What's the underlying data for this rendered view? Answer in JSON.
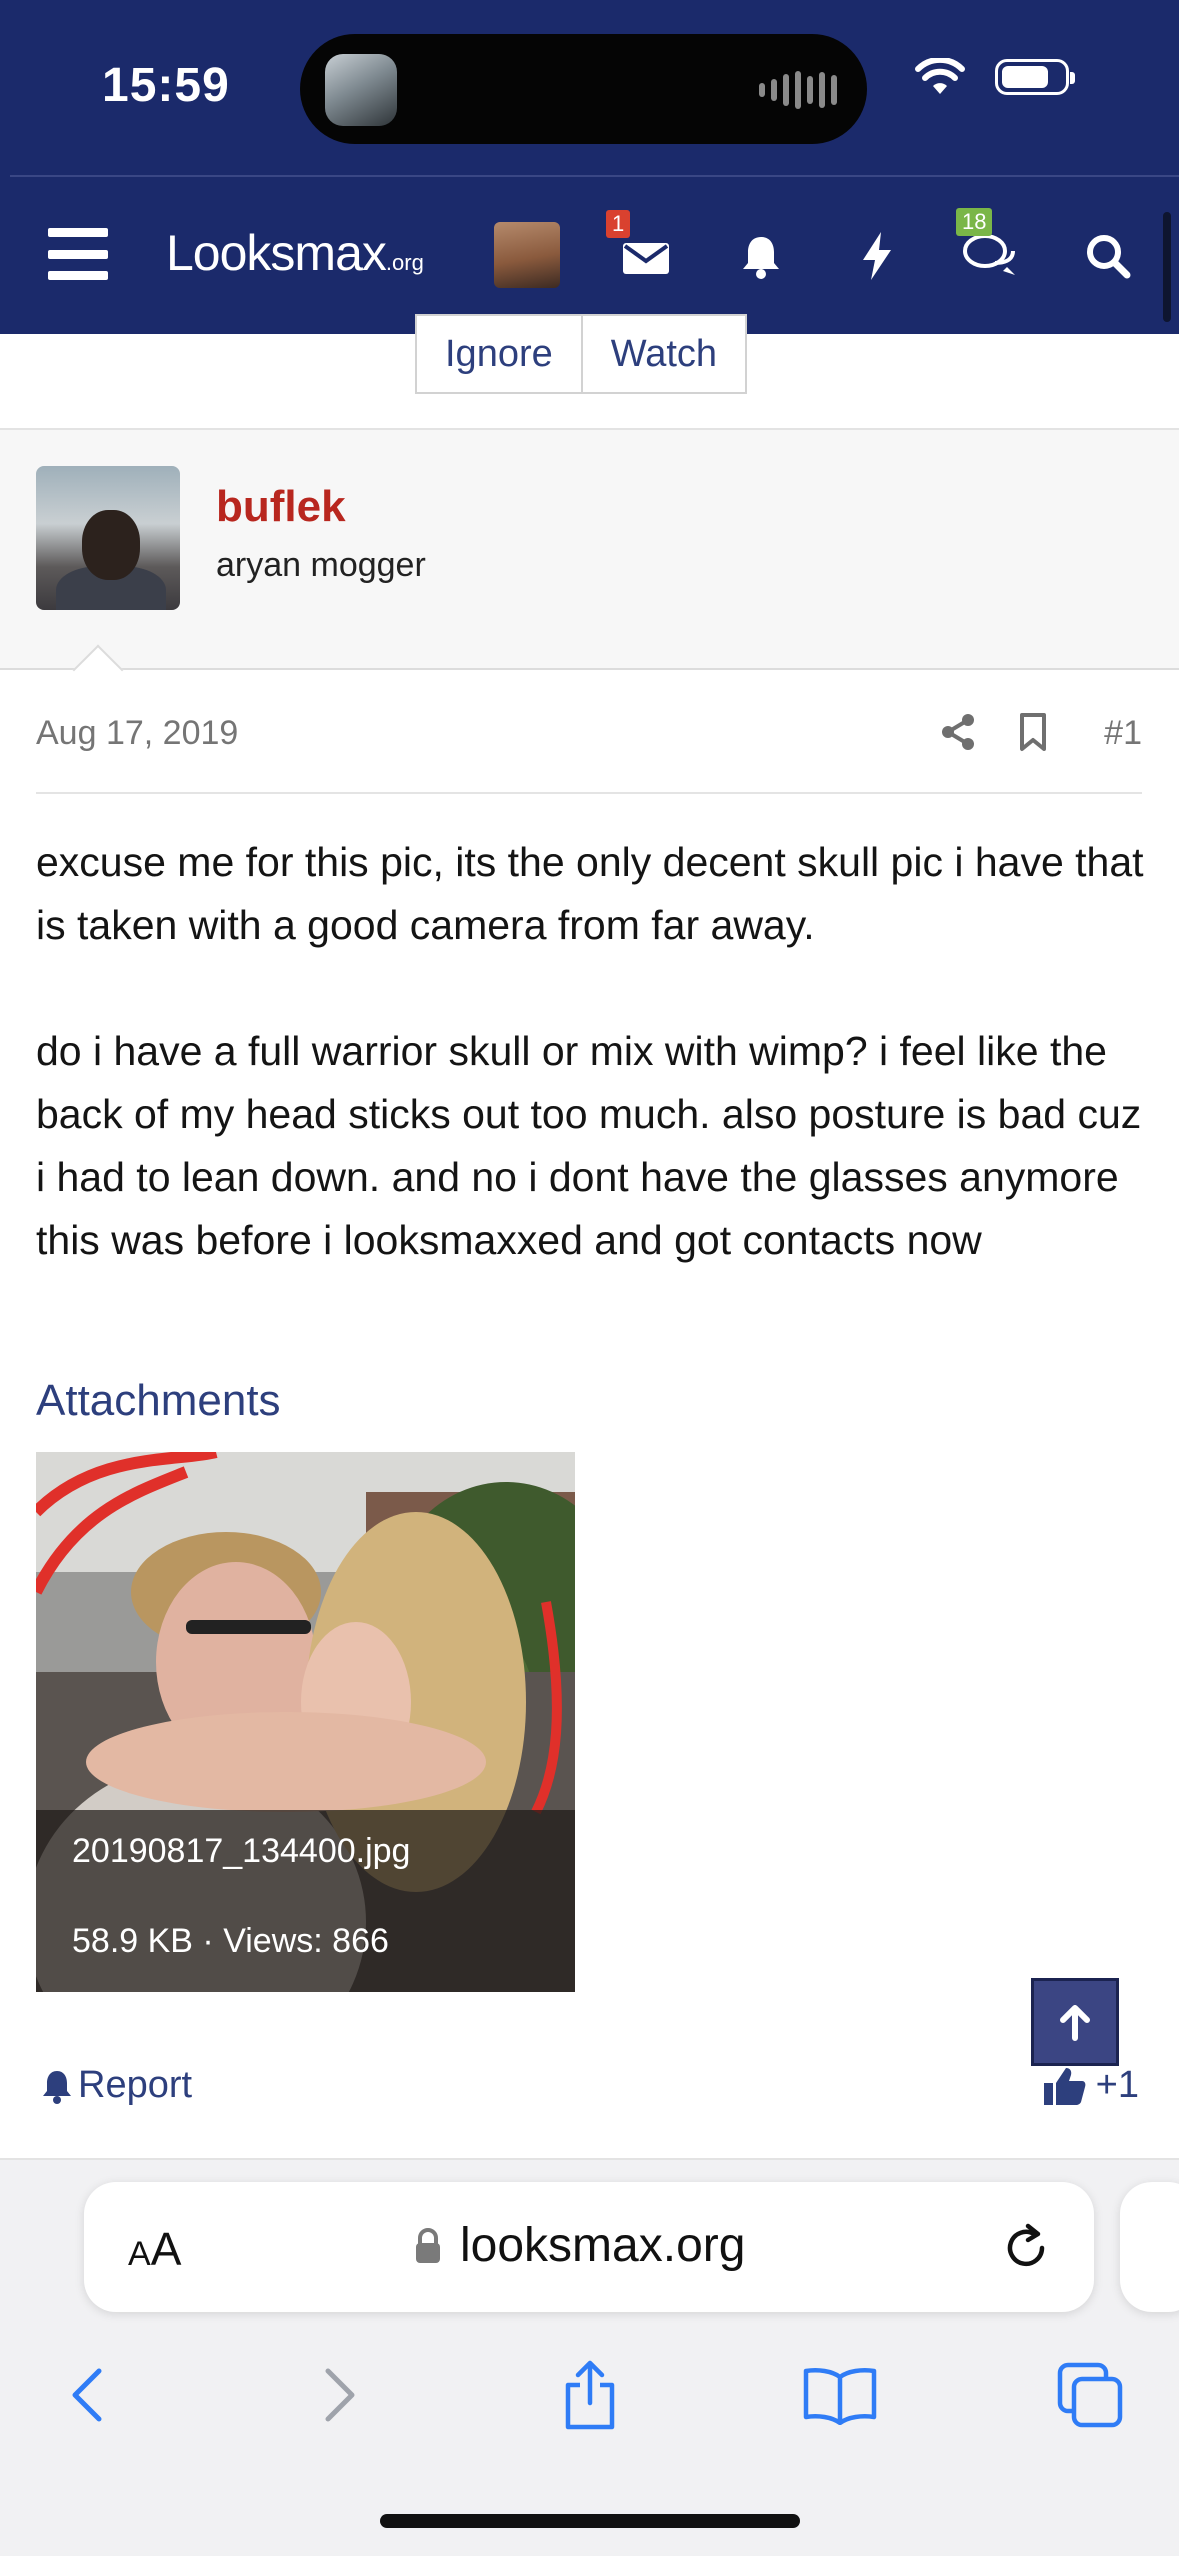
{
  "status_bar": {
    "time": "15:59"
  },
  "nav": {
    "logo_main": "Looksmax",
    "logo_suffix": ".org",
    "inbox_count": "1",
    "alerts_count": "18"
  },
  "thread_controls": {
    "ignore_label": "Ignore",
    "watch_label": "Watch"
  },
  "post": {
    "username": "buflek",
    "user_title": "aryan mogger",
    "date": "Aug 17, 2019",
    "number": "#1",
    "body": [
      "excuse me for this pic, its the only decent skull pic i have that is taken with a good camera from far away.",
      "do i have a full warrior skull or mix with wimp? i feel like the back of my head sticks out too much. also posture is bad cuz i had to lean down. and no i dont have the glasses anymore this was before i looksmaxxed and got contacts now"
    ],
    "attachments_title": "Attachments",
    "attachment": {
      "filename": "20190817_134400.jpg",
      "meta": "58.9 KB · Views: 866"
    },
    "report_label": "Report",
    "reaction_label": "+1"
  },
  "safari": {
    "aa_label": "AA",
    "url": "looksmax.org"
  },
  "colors": {
    "navy": "#1b2a6b",
    "username_red": "#b8271f",
    "link_blue": "#2d3f7d",
    "badge_red": "#d9412f",
    "badge_green": "#7ab648"
  }
}
